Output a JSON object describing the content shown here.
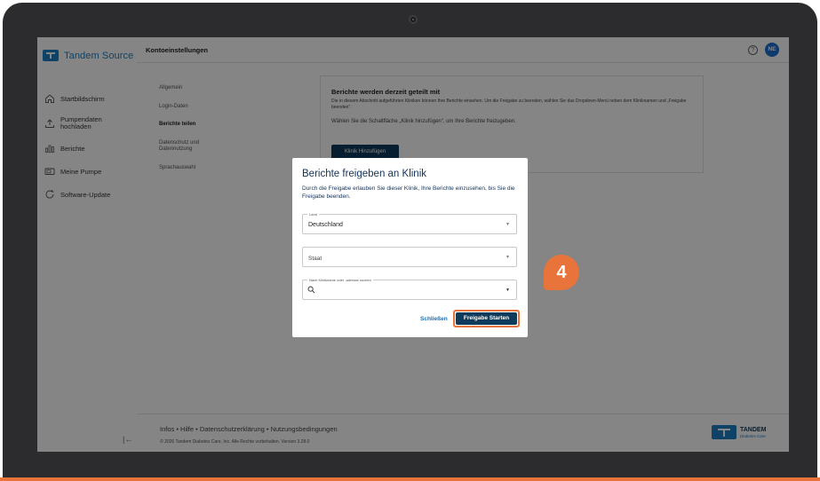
{
  "sidebar": {
    "logo_text": "Tandem Source",
    "items": [
      {
        "label": "Startbildschirm",
        "icon": "home-icon"
      },
      {
        "label": "Pumpendaten hochladen",
        "icon": "upload-icon"
      },
      {
        "label": "Berichte",
        "icon": "reports-icon"
      },
      {
        "label": "Meine Pumpe",
        "icon": "pump-icon"
      },
      {
        "label": "Software-Update",
        "icon": "refresh-icon"
      }
    ],
    "collapse_glyph": "|←"
  },
  "header": {
    "title": "Kontoeinstellungen",
    "help_glyph": "?",
    "avatar_initials": "NE"
  },
  "subnav": {
    "items": [
      {
        "label": "Allgemein",
        "active": false
      },
      {
        "label": "Login-Daten",
        "active": false
      },
      {
        "label": "Berichte teilen",
        "active": true
      },
      {
        "label": "Datenschutz und Datennutzung",
        "active": false
      },
      {
        "label": "Sprachauswahl",
        "active": false
      }
    ]
  },
  "card": {
    "title": "Berichte werden derzeit geteilt mit",
    "text1": "Die in diesem Abschnitt aufgeführten Kliniken können Ihre Berichte einsehen. Um die Freigabe zu beenden, wählen Sie das Dropdown-Menü neben dem Kliniknamen und „Freigabe beenden“.",
    "text2": "Wählen Sie die Schaltfläche „Klinik hinzufügen“, um Ihre Berichte freizugeben.",
    "button": "Klinik Hinzufügen"
  },
  "modal": {
    "title": "Berichte freigeben an Klinik",
    "description": "Durch die Freigabe erlauben Sie dieser Klinik, Ihre Berichte einzusehen, bis Sie die Freigabe beenden.",
    "country": {
      "label": "Land",
      "value": "Deutschland"
    },
    "state": {
      "placeholder": "Staat"
    },
    "search": {
      "label": "Nach Klinikname oder -adresse suchen",
      "value": ""
    },
    "close_button": "Schließen",
    "start_button": "Freigabe Starten"
  },
  "step_badge": "4",
  "footer": {
    "links": "Infos • Hilfe • Datenschutzerklärung • Nutzungsbedingungen",
    "copyright": "© 2026 Tandem Diabetes Care, Inc. Alle Rechte vorbehalten. Version 3.28.0",
    "brand_name": "TANDEM",
    "brand_sub": "Diabetes Care"
  },
  "colors": {
    "accent_orange": "#e8743b",
    "navy": "#0e3a5c",
    "brand_blue": "#1b7fc4"
  }
}
